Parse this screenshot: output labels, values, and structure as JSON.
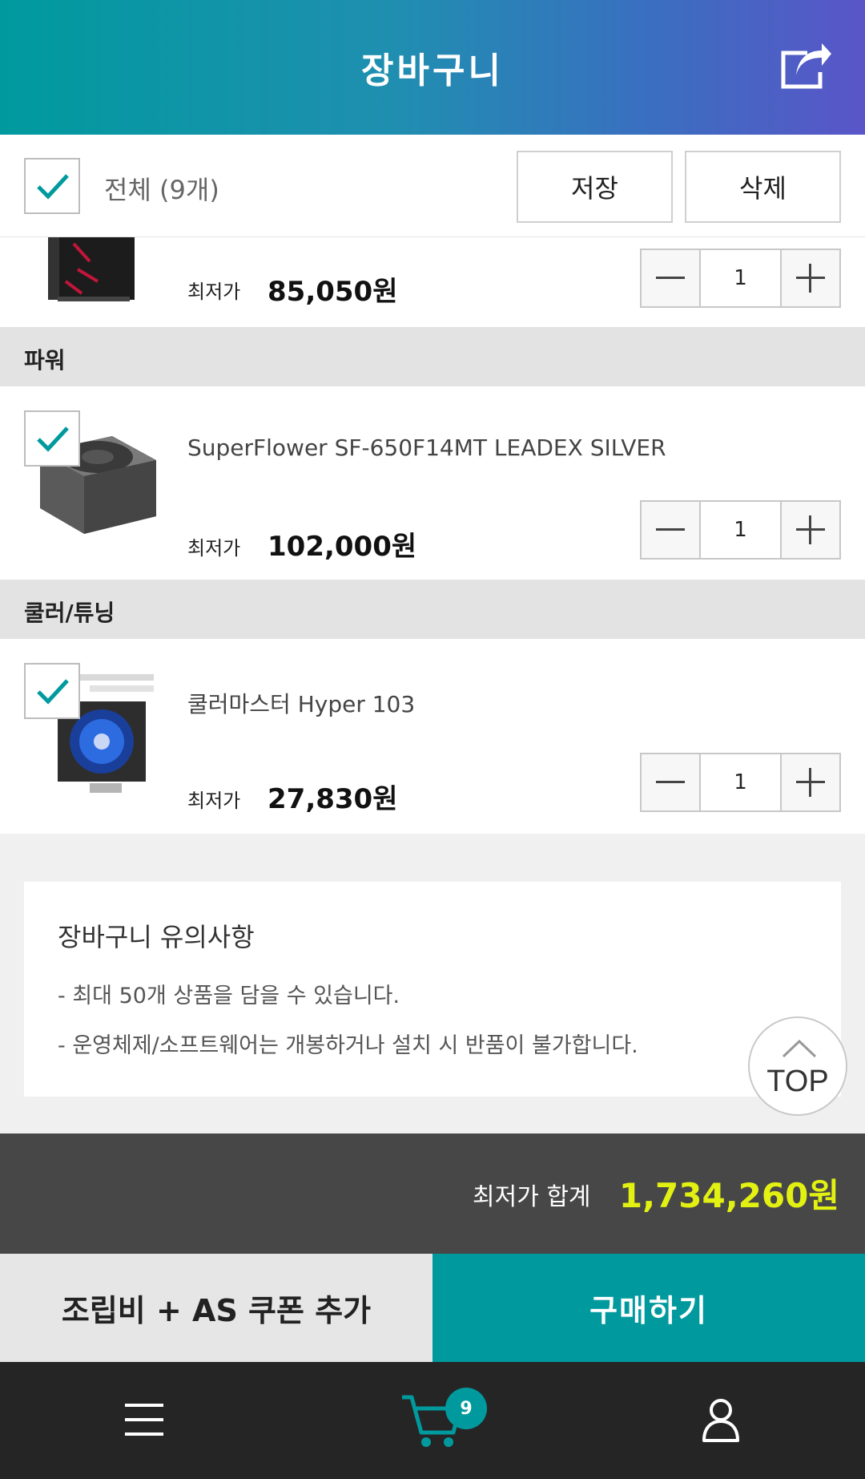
{
  "header": {
    "title": "장바구니"
  },
  "toolbar": {
    "select_all_label": "전체 (9개)",
    "save_label": "저장",
    "delete_label": "삭제"
  },
  "items": [
    {
      "price_label": "최저가",
      "price": "85,050원",
      "quantity": "1"
    },
    {
      "category": "파워",
      "name": "SuperFlower SF-650F14MT LEADEX SILVER",
      "price_label": "최저가",
      "price": "102,000원",
      "quantity": "1"
    },
    {
      "category": "쿨러/튜닝",
      "name": "쿨러마스터 Hyper 103",
      "price_label": "최저가",
      "price": "27,830원",
      "quantity": "1"
    }
  ],
  "notice": {
    "title": "장바구니 유의사항",
    "lines": [
      "- 최대 50개 상품을 담을 수 있습니다.",
      "- 운영체제/소프트웨어는 개봉하거나 설치 시 반품이 불가합니다."
    ]
  },
  "top_button": {
    "label": "TOP"
  },
  "total": {
    "label": "최저가 합계",
    "value": "1,734,260원"
  },
  "actions": {
    "coupon_label": "조립비 + AS 쿠폰 추가",
    "buy_label": "구매하기"
  },
  "nav": {
    "cart_count": "9"
  },
  "colors": {
    "accent": "#009a9e",
    "total_value": "#e2f012",
    "header_gradient_end": "#5a55c8"
  }
}
